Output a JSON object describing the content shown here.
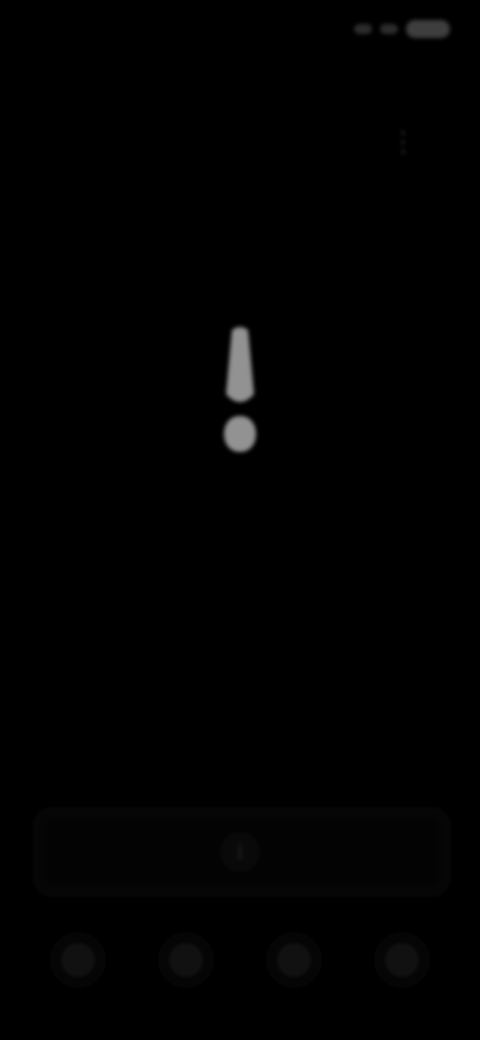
{
  "statusBar": {
    "time": "",
    "rightIcons": [
      "signal-icon",
      "wifi-icon",
      "battery-icon"
    ]
  },
  "header": {
    "title": "",
    "actionIcon": "more-icon"
  },
  "main": {
    "icon": "exclamation-icon",
    "title": "",
    "subtitle": ""
  },
  "bottomPanel": {
    "centerIcon": "info-icon"
  },
  "nav": {
    "items": [
      {
        "icon": "home-icon"
      },
      {
        "icon": "circle-icon"
      },
      {
        "icon": "circle-icon"
      },
      {
        "icon": "user-icon"
      }
    ]
  },
  "colors": {
    "background": "#000000",
    "foreground": "#d9d9d9"
  }
}
